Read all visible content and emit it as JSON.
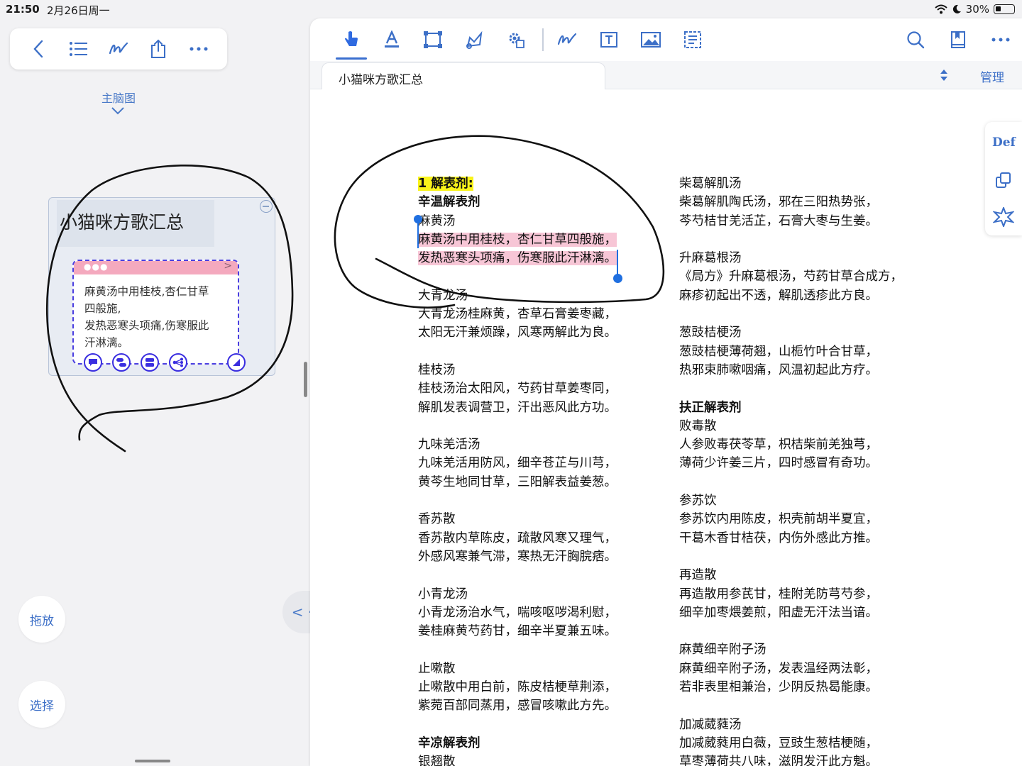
{
  "status": {
    "time": "21:50",
    "date": "2月26日周一",
    "battery": "30%"
  },
  "left": {
    "mindmap_label": "主脑图",
    "canvas_title": "小猫咪方歌汇总",
    "card_lines": [
      "麻黄汤中用桂枝,杏仁甘草",
      "四般施,",
      "发热恶寒头项痛,伤寒服此",
      "汗淋漓。"
    ],
    "drag_label": "拖放",
    "select_label": "选择"
  },
  "nav_pill": "< · >",
  "doc": {
    "tab_title": "小猫咪方歌汇总",
    "manage_label": "管理",
    "def_label": "Def",
    "left_col": [
      {
        "t": "1 解表剂:",
        "s": "heading-hl"
      },
      {
        "t": "辛温解表剂",
        "s": "bold"
      },
      {
        "t": "麻黄汤",
        "s": ""
      },
      {
        "t": "麻黄汤中用桂枝，杏仁甘草四般施，",
        "s": "pink"
      },
      {
        "t": "发热恶寒头项痛，伤寒服此汗淋漓。",
        "s": "pink"
      },
      {
        "t": "",
        "s": "gap"
      },
      {
        "t": "大青龙汤",
        "s": ""
      },
      {
        "t": "大青龙汤桂麻黄，杏草石膏姜枣藏，",
        "s": ""
      },
      {
        "t": "太阳无汗兼烦躁，风寒两解此为良。",
        "s": ""
      },
      {
        "t": "",
        "s": "gap"
      },
      {
        "t": "桂枝汤",
        "s": ""
      },
      {
        "t": "桂枝汤治太阳风，芍药甘草姜枣同，",
        "s": ""
      },
      {
        "t": "解肌发表调营卫，汗出恶风此方功。",
        "s": ""
      },
      {
        "t": "",
        "s": "gap"
      },
      {
        "t": "九味羌活汤",
        "s": ""
      },
      {
        "t": "九味羌活用防风，细辛苍芷与川芎，",
        "s": ""
      },
      {
        "t": "黄芩生地同甘草，三阳解表益姜葱。",
        "s": ""
      },
      {
        "t": "",
        "s": "gap"
      },
      {
        "t": "香苏散",
        "s": ""
      },
      {
        "t": "香苏散内草陈皮，疏散风寒又理气，",
        "s": ""
      },
      {
        "t": "外感风寒兼气滞，寒热无汗胸脘痞。",
        "s": ""
      },
      {
        "t": "",
        "s": "gap"
      },
      {
        "t": "小青龙汤",
        "s": ""
      },
      {
        "t": "小青龙汤治水气，喘咳呕哕渴利慰，",
        "s": ""
      },
      {
        "t": "姜桂麻黄芍药甘，细辛半夏兼五味。",
        "s": ""
      },
      {
        "t": "",
        "s": "gap"
      },
      {
        "t": "止嗽散",
        "s": ""
      },
      {
        "t": "止嗽散中用白前，陈皮桔梗草荆添，",
        "s": ""
      },
      {
        "t": "紫菀百部同蒸用，感冒咳嗽此方先。",
        "s": ""
      },
      {
        "t": "",
        "s": "gap"
      },
      {
        "t": "辛凉解表剂",
        "s": "bold"
      },
      {
        "t": "银翘散",
        "s": ""
      }
    ],
    "right_col": [
      {
        "t": "柴葛解肌汤",
        "s": ""
      },
      {
        "t": "柴葛解肌陶氏汤，邪在三阳热势张，",
        "s": ""
      },
      {
        "t": "芩芍桔甘羌活芷，石膏大枣与生姜。",
        "s": ""
      },
      {
        "t": "",
        "s": "gap"
      },
      {
        "t": "升麻葛根汤",
        "s": ""
      },
      {
        "t": "《局方》升麻葛根汤，芍药甘草合成方，",
        "s": ""
      },
      {
        "t": "麻疹初起出不透，解肌透疹此方良。",
        "s": ""
      },
      {
        "t": "",
        "s": "gap"
      },
      {
        "t": "葱豉桔梗汤",
        "s": ""
      },
      {
        "t": "葱豉桔梗薄荷翘，山栀竹叶合甘草，",
        "s": ""
      },
      {
        "t": "热邪束肺嗽咽痛，风温初起此方疗。",
        "s": ""
      },
      {
        "t": "",
        "s": "gap"
      },
      {
        "t": "扶正解表剂",
        "s": "bold"
      },
      {
        "t": "败毒散",
        "s": ""
      },
      {
        "t": "人参败毒茯苓草，枳桔柴前羌独芎，",
        "s": ""
      },
      {
        "t": "薄荷少许姜三片，四时感冒有奇功。",
        "s": ""
      },
      {
        "t": "",
        "s": "gap"
      },
      {
        "t": "参苏饮",
        "s": ""
      },
      {
        "t": "参苏饮内用陈皮，枳壳前胡半夏宜，",
        "s": ""
      },
      {
        "t": "干葛木香甘桔茯，内伤外感此方推。",
        "s": ""
      },
      {
        "t": "",
        "s": "gap"
      },
      {
        "t": "再造散",
        "s": ""
      },
      {
        "t": "再造散用参芪甘，桂附羌防芎芍参，",
        "s": ""
      },
      {
        "t": "细辛加枣煨姜煎，阳虚无汗法当谙。",
        "s": ""
      },
      {
        "t": "",
        "s": "gap"
      },
      {
        "t": "麻黄细辛附子汤",
        "s": ""
      },
      {
        "t": "麻黄细辛附子汤，发表温经两法彰，",
        "s": ""
      },
      {
        "t": "若非表里相兼治，少阴反热曷能康。",
        "s": ""
      },
      {
        "t": "",
        "s": "gap"
      },
      {
        "t": "加减葳蕤汤",
        "s": ""
      },
      {
        "t": "加减葳蕤用白薇，豆豉生葱桔梗随，",
        "s": ""
      },
      {
        "t": "草枣薄荷共八味，滋阴发汗此方魁。",
        "s": ""
      }
    ]
  },
  "colors": {
    "accent": "#3c6fc7",
    "highlight_yellow": "#f9f31a",
    "highlight_pink": "#f7c6d6",
    "card_header": "#f4a9be",
    "selection": "#1f6fe0"
  }
}
